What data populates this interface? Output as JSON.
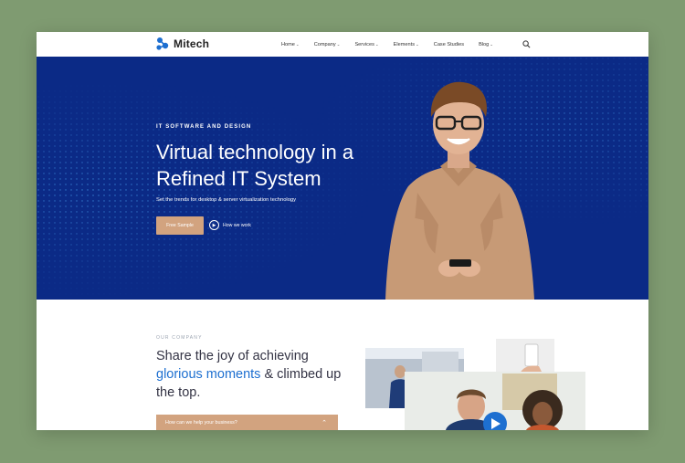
{
  "brand": {
    "name": "Mitech",
    "color": "#1d6fd0"
  },
  "nav": {
    "items": [
      {
        "label": "Home",
        "has_dropdown": true
      },
      {
        "label": "Company",
        "has_dropdown": true
      },
      {
        "label": "Services",
        "has_dropdown": true
      },
      {
        "label": "Elements",
        "has_dropdown": true
      },
      {
        "label": "Case Studies",
        "has_dropdown": false
      },
      {
        "label": "Blog",
        "has_dropdown": true
      }
    ],
    "search_icon": "search-icon"
  },
  "hero": {
    "eyebrow": "IT SOFTWARE AND DESIGN",
    "title_line1": "Virtual technology in a",
    "title_line2": "Refined IT System",
    "subtitle": "Set the trends for desktop & server virtualization technology",
    "primary_button": "Free Sample",
    "secondary_link": "How we work",
    "background": "#0b2a86",
    "accent": "#d2a37f"
  },
  "company": {
    "eyebrow": "OUR COMPANY",
    "title_part1": "Share the joy of achieving",
    "title_highlight": "glorious moments",
    "title_part2": "& climbed up the top.",
    "accordion_label": "How can we help your business?"
  }
}
